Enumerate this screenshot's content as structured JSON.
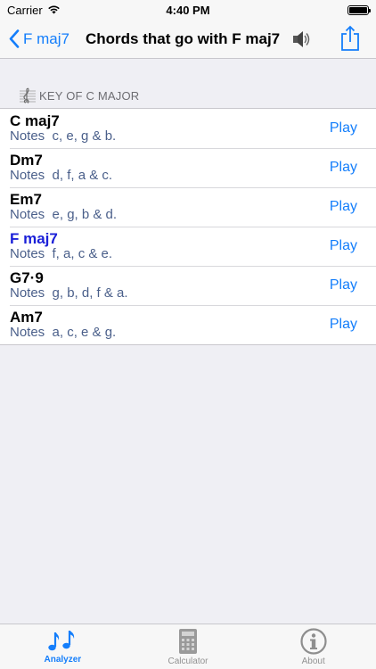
{
  "status_bar": {
    "carrier": "Carrier",
    "time": "4:40 PM"
  },
  "nav": {
    "back_label": "F maj7",
    "title": "Chords that go with F maj7",
    "speaker_icon": "speaker-icon",
    "share_icon": "share-icon"
  },
  "section": {
    "header": "KEY OF C MAJOR",
    "icon": "treble-clef-icon"
  },
  "chords": [
    {
      "name": "C maj7",
      "notes": "Notes  c, e, g & b.",
      "play": "Play",
      "current": false
    },
    {
      "name": "Dm7",
      "notes": "Notes  d, f, a & c.",
      "play": "Play",
      "current": false
    },
    {
      "name": "Em7",
      "notes": "Notes  e, g, b & d.",
      "play": "Play",
      "current": false
    },
    {
      "name": "F maj7",
      "notes": "Notes  f, a, c & e.",
      "play": "Play",
      "current": true
    },
    {
      "name": "G7·9",
      "notes": "Notes  g, b, d, f & a.",
      "play": "Play",
      "current": false
    },
    {
      "name": "Am7",
      "notes": "Notes  a, c, e & g.",
      "play": "Play",
      "current": false
    }
  ],
  "tabs": [
    {
      "label": "Analyzer",
      "icon": "music-notes-icon",
      "active": true
    },
    {
      "label": "Calculator",
      "icon": "calculator-icon",
      "active": false
    },
    {
      "label": "About",
      "icon": "info-icon",
      "active": false
    }
  ],
  "colors": {
    "accent": "#147efb",
    "current_chord": "#1a1fd8",
    "notes_text": "#4a5f8a",
    "background": "#efeff4"
  }
}
